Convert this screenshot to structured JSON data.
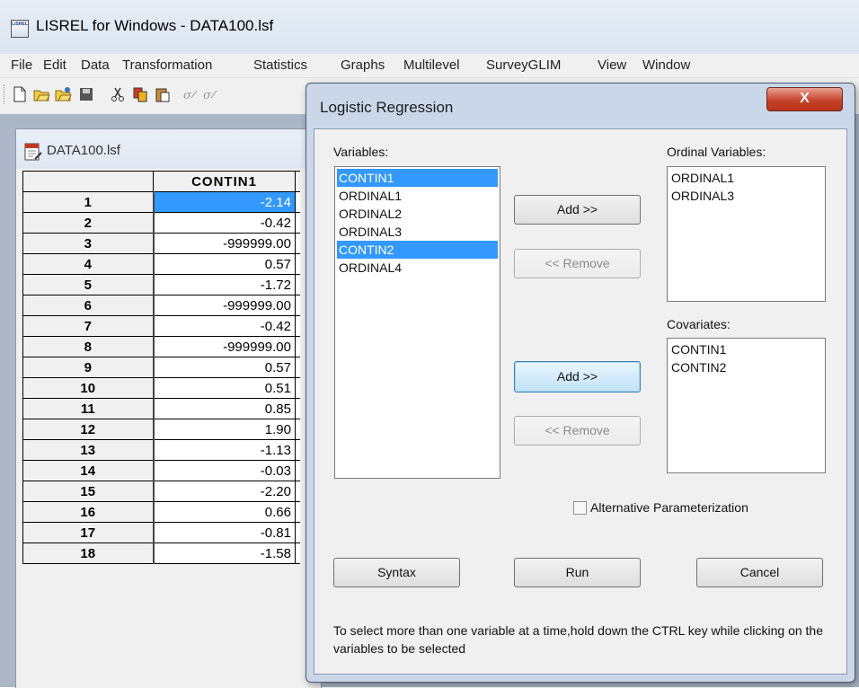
{
  "app": {
    "title": "LISREL for Windows - DATA100.lsf",
    "icon_glyph": "LISREL"
  },
  "menu": [
    "File",
    "Edit",
    "Data",
    "Transformation",
    "Statistics",
    "Graphs",
    "Multilevel",
    "SurveyGLIM",
    "View",
    "Window"
  ],
  "toolbar": {
    "buttons": [
      "new-file-icon",
      "open-file-icon",
      "open-folder-icon",
      "save-icon",
      "cut-icon",
      "copy-icon",
      "paste-icon",
      "stats-icon",
      "stats-icon-2"
    ]
  },
  "spreadsheet": {
    "title": "DATA100.lsf",
    "column_header": "CONTIN1",
    "rows": [
      {
        "n": "1",
        "v": "-2.14"
      },
      {
        "n": "2",
        "v": "-0.42"
      },
      {
        "n": "3",
        "v": "-999999.00"
      },
      {
        "n": "4",
        "v": "0.57"
      },
      {
        "n": "5",
        "v": "-1.72"
      },
      {
        "n": "6",
        "v": "-999999.00"
      },
      {
        "n": "7",
        "v": "-0.42"
      },
      {
        "n": "8",
        "v": "-999999.00"
      },
      {
        "n": "9",
        "v": "0.57"
      },
      {
        "n": "10",
        "v": "0.51"
      },
      {
        "n": "11",
        "v": "0.85"
      },
      {
        "n": "12",
        "v": "1.90"
      },
      {
        "n": "13",
        "v": "-1.13"
      },
      {
        "n": "14",
        "v": "-0.03"
      },
      {
        "n": "15",
        "v": "-2.20"
      },
      {
        "n": "16",
        "v": "0.66"
      },
      {
        "n": "17",
        "v": "-0.81"
      },
      {
        "n": "18",
        "v": "-1.58"
      }
    ],
    "selected_row": "1"
  },
  "dialog": {
    "title": "Logistic Regression",
    "close_label": "X",
    "variables_label": "Variables:",
    "variables": [
      "CONTIN1",
      "ORDINAL1",
      "ORDINAL2",
      "ORDINAL3",
      "CONTIN2",
      "ORDINAL4"
    ],
    "selected_variables": [
      "CONTIN1",
      "CONTIN2"
    ],
    "ordinal_label": "Ordinal Variables:",
    "ordinal_variables": [
      "ORDINAL1",
      "ORDINAL3"
    ],
    "covariates_label": "Covariates:",
    "covariates": [
      "CONTIN1",
      "CONTIN2"
    ],
    "add_label": "Add >>",
    "remove_label": "<< Remove",
    "alt_param_label": "Alternative Parameterization",
    "alt_param_checked": false,
    "syntax_label": "Syntax",
    "run_label": "Run",
    "cancel_label": "Cancel",
    "help_text": "To select more than one variable at a time,hold down the CTRL key while clicking on the variables to be selected"
  },
  "colors": {
    "selection": "#3399ff",
    "dialog_frame": "#c9d7e8",
    "mdi_background": "#abb6c6",
    "close_button": "#c5432b"
  }
}
